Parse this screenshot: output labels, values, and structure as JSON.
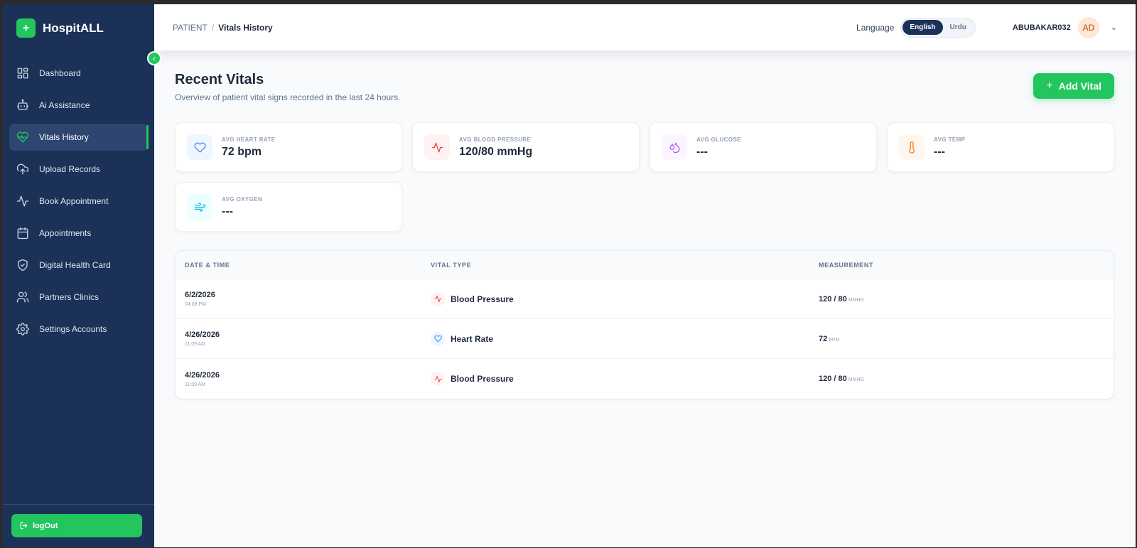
{
  "brand": {
    "name": "HospitALL",
    "logo_symbol": "+"
  },
  "sidebar": {
    "items": [
      {
        "label": "Dashboard",
        "icon": "dashboard-icon"
      },
      {
        "label": "Ai Assistance",
        "icon": "robot-icon"
      },
      {
        "label": "Vitals History",
        "icon": "heart-pulse-icon",
        "active": true
      },
      {
        "label": "Upload Records",
        "icon": "cloud-upload-icon"
      },
      {
        "label": "Book Appointment",
        "icon": "activity-icon"
      },
      {
        "label": "Appointments",
        "icon": "calendar-icon"
      },
      {
        "label": "Digital Health Card",
        "icon": "shield-check-icon"
      },
      {
        "label": "Partners Clinics",
        "icon": "users-icon"
      },
      {
        "label": "Settings Accounts",
        "icon": "gear-icon"
      }
    ],
    "logout_label": "logOut"
  },
  "header": {
    "breadcrumb_root": "PATIENT",
    "breadcrumb_separator": "/",
    "breadcrumb_current": "Vitals History",
    "language_label": "Language",
    "language_options": [
      "English",
      "Urdu"
    ],
    "language_selected": "English",
    "username": "ABUBAKAR032",
    "avatar_initials": "AD"
  },
  "page": {
    "title": "Recent Vitals",
    "subtitle": "Overview of patient vital signs recorded in the last 24 hours.",
    "add_button_label": "Add Vital"
  },
  "stats": [
    {
      "label": "AVG HEART RATE",
      "value": "72 bpm",
      "icon": "heart-icon",
      "color": "#3b82f6",
      "bg": "#eff6ff"
    },
    {
      "label": "AVG BLOOD PRESSURE",
      "value": "120/80 mmHg",
      "icon": "activity-icon",
      "color": "#ef4444",
      "bg": "#fef2f2"
    },
    {
      "label": "AVG GLUCOSE",
      "value": "---",
      "icon": "droplets-icon",
      "color": "#a855f7",
      "bg": "#faf5ff"
    },
    {
      "label": "AVG TEMP",
      "value": "---",
      "icon": "thermometer-icon",
      "color": "#f97316",
      "bg": "#fff7ed"
    },
    {
      "label": "AVG OXYGEN",
      "value": "---",
      "icon": "wind-icon",
      "color": "#06b6d4",
      "bg": "#ecfeff"
    }
  ],
  "table": {
    "columns": [
      "DATE & TIME",
      "VITAL TYPE",
      "MEASUREMENT"
    ],
    "rows": [
      {
        "date": "6/2/2026",
        "time": "04:08 PM",
        "type": "Blood Pressure",
        "icon": "activity-icon",
        "value": "120 / 80",
        "unit": "MMHG"
      },
      {
        "date": "4/26/2026",
        "time": "11:09 AM",
        "type": "Heart Rate",
        "icon": "heart-icon",
        "value": "72",
        "unit": "BPM"
      },
      {
        "date": "4/26/2026",
        "time": "11:09 AM",
        "type": "Blood Pressure",
        "icon": "activity-icon",
        "value": "120 / 80",
        "unit": "MMHG"
      }
    ]
  },
  "colors": {
    "sidebar_bg": "#1c3158",
    "accent": "#22c55e",
    "active_item_bg": "#2d4570"
  }
}
